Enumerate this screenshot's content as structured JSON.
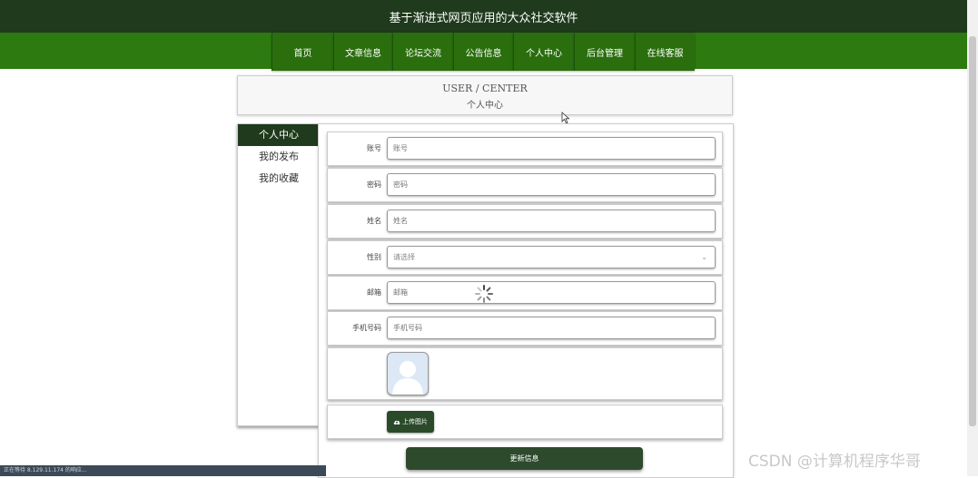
{
  "app": {
    "title": "基于渐进式网页应用的大众社交软件"
  },
  "nav": {
    "items": [
      {
        "label": "首页",
        "id": "home"
      },
      {
        "label": "文章信息",
        "id": "articles"
      },
      {
        "label": "论坛交流",
        "id": "forum"
      },
      {
        "label": "公告信息",
        "id": "notices"
      },
      {
        "label": "个人中心",
        "id": "user-center"
      },
      {
        "label": "后台管理",
        "id": "admin"
      },
      {
        "label": "在线客服",
        "id": "support"
      }
    ]
  },
  "header": {
    "title_en": "USER / CENTER",
    "title_cn": "个人中心"
  },
  "sidebar": {
    "items": [
      {
        "label": "个人中心",
        "active": true
      },
      {
        "label": "我的发布",
        "active": false
      },
      {
        "label": "我的收藏",
        "active": false
      }
    ]
  },
  "form": {
    "account": {
      "label": "账号",
      "placeholder": "账号"
    },
    "password": {
      "label": "密码",
      "placeholder": "密码"
    },
    "name": {
      "label": "姓名",
      "placeholder": "姓名"
    },
    "gender": {
      "label": "性别",
      "placeholder": "请选择"
    },
    "email": {
      "label": "邮箱",
      "placeholder": "邮箱"
    },
    "phone": {
      "label": "手机号码",
      "placeholder": "手机号码"
    },
    "upload_label": "上传图片",
    "submit_label": "更新信息"
  },
  "status_bar": {
    "text": "正在等待 8.129.11.174 的响应..."
  },
  "watermark": "CSDN @计算机程序华哥",
  "colors": {
    "title_bar": "#1f3a1c",
    "nav_bar": "#2d7a10",
    "button_dark": "#2e4a2c"
  },
  "icons": {
    "upload": "cloud-upload-icon",
    "select": "chevron-down-icon",
    "loading": "spinner-icon"
  }
}
